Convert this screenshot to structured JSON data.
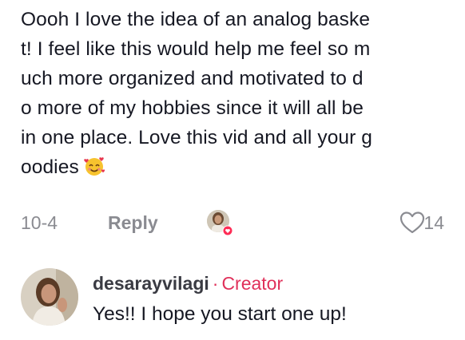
{
  "comment": {
    "lines": [
      "Oooh I love the idea of an analog baske",
      "t! I feel like this would help me feel so m",
      "uch more organized and motivated to d",
      "o more of my hobbies since it will all be",
      "in one place. Love this vid and all your g",
      "oodies"
    ],
    "emoji": "smiling-face-with-hearts-icon",
    "date": "10-4",
    "reply_label": "Reply",
    "like_count": "14"
  },
  "reply": {
    "author": "desarayvilagi",
    "separator": "·",
    "badge": "Creator",
    "text": "Yes!! I hope you start one up!"
  },
  "colors": {
    "text": "#161823",
    "muted": "#8a8b91",
    "accent": "#e0305a"
  }
}
